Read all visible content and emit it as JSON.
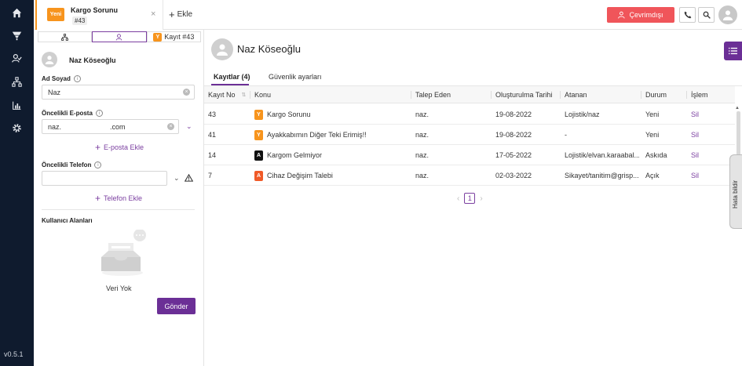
{
  "app": {
    "version": "v0.5.1"
  },
  "nav": {
    "items": [
      "home-icon",
      "funnel-icon",
      "users-icon",
      "sitemap-icon",
      "chart-icon",
      "gear-icon"
    ]
  },
  "tabbar": {
    "tab": {
      "badge": "Yeni",
      "title": "Kargo Sorunu",
      "number": "#43",
      "close": "×"
    },
    "add_label": "Ekle",
    "offline_label": "Çevrimdışı"
  },
  "side": {
    "tabs": {
      "record_badge": "Y",
      "record_label": "Kayıt #43"
    },
    "person_name": "Naz Köseoğlu",
    "name_label": "Ad Soyad",
    "name_value": "Naz",
    "email_label": "Öncelikli E-posta",
    "email_value_user": "naz.",
    "email_value_domain": ".com",
    "add_email": "E-posta Ekle",
    "phone_label": "Öncelikli Telefon",
    "phone_value": "",
    "add_phone": "Telefon Ekle",
    "custom_fields_title": "Kullanıcı Alanları",
    "empty_text": "Veri Yok",
    "send_label": "Gönder"
  },
  "main": {
    "name": "Naz Köseoğlu",
    "tabs": [
      {
        "label": "Kayıtlar (4)"
      },
      {
        "label": "Güvenlik ayarları"
      }
    ],
    "columns": [
      "Kayıt No",
      "Konu",
      "Talep Eden",
      "Oluşturulma Tarihi",
      "Atanan",
      "Durum",
      "İşlem"
    ],
    "rows": [
      {
        "no": "43",
        "badge": "Y",
        "badge_color": "#f7941d",
        "subject": "Kargo Sorunu",
        "requester": "naz.",
        "created": "19-08-2022",
        "assignee": "Lojistik/naz",
        "status": "Yeni",
        "action": "Sil"
      },
      {
        "no": "41",
        "badge": "Y",
        "badge_color": "#f7941d",
        "subject": "Ayakkabımın Diğer Teki Erimiş!!",
        "requester": "naz.",
        "created": "19-08-2022",
        "assignee": "-",
        "status": "Yeni",
        "action": "Sil"
      },
      {
        "no": "14",
        "badge": "A",
        "badge_color": "#111111",
        "subject": "Kargom Gelmiyor",
        "requester": "naz.",
        "created": "17-05-2022",
        "assignee": "Lojistik/elvan.karaabal...",
        "status": "Askıda",
        "action": "Sil"
      },
      {
        "no": "7",
        "badge": "A",
        "badge_color": "#f05a28",
        "subject": "Cihaz Değişim Talebi",
        "requester": "naz.",
        "created": "02-03-2022",
        "assignee": "Sikayet/tanitim@grisp...",
        "status": "Açık",
        "action": "Sil"
      }
    ],
    "pagination": {
      "current": "1",
      "prev": "‹",
      "next": "›"
    },
    "bug_tab": "Hata bildir"
  },
  "colors": {
    "accent": "#6b2f96",
    "danger": "#f0555a",
    "orange": "#f7941d",
    "nav_bg": "#0f1b2e"
  }
}
